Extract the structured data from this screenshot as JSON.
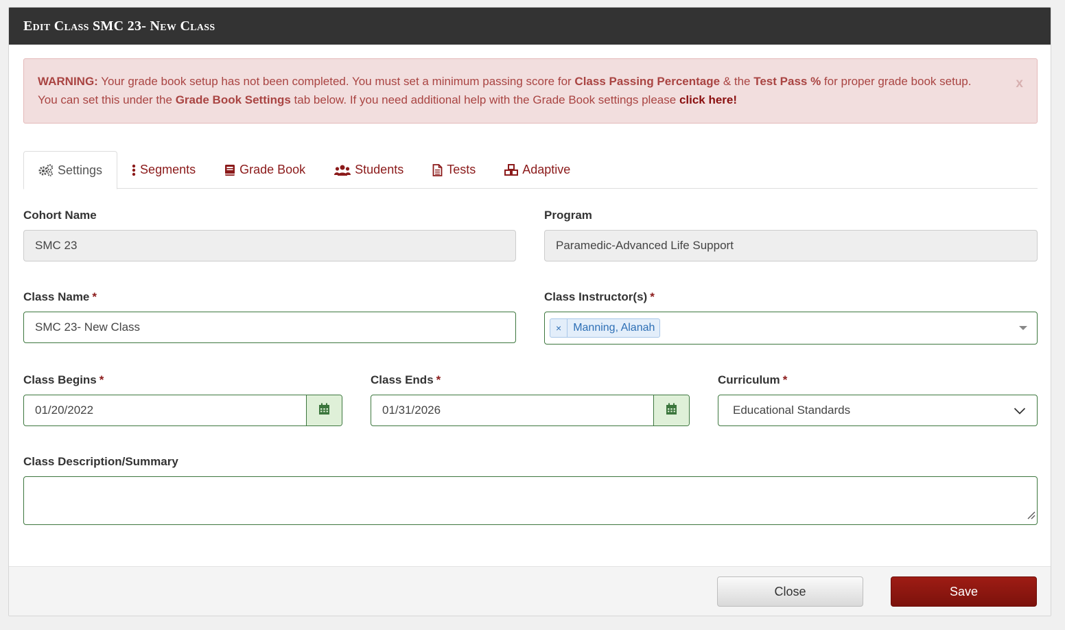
{
  "modal": {
    "title": "Edit Class SMC 23- New Class"
  },
  "alert": {
    "prefix": "WARNING:",
    "text1": " Your grade book setup has not been completed. You must set a minimum passing score for ",
    "bold1": "Class Passing Percentage",
    "text2": " & the ",
    "bold2": "Test Pass %",
    "text3": " for proper grade book setup.",
    "text4": "You can set this under the ",
    "bold3": "Grade Book Settings",
    "text5": " tab below. If you need additional help with the Grade Book settings please ",
    "link": "click here!",
    "close": "x"
  },
  "tabs": [
    {
      "label": "Settings",
      "icon": "gears-icon"
    },
    {
      "label": "Segments",
      "icon": "vertical-ellipsis-icon"
    },
    {
      "label": "Grade Book",
      "icon": "book-icon"
    },
    {
      "label": "Students",
      "icon": "users-icon"
    },
    {
      "label": "Tests",
      "icon": "file-text-icon"
    },
    {
      "label": "Adaptive",
      "icon": "cubes-icon"
    }
  ],
  "form": {
    "cohort_name": {
      "label": "Cohort Name",
      "value": "SMC 23"
    },
    "program": {
      "label": "Program",
      "value": "Paramedic-Advanced Life Support"
    },
    "class_name": {
      "label": "Class Name",
      "value": "SMC 23- New Class"
    },
    "instructors": {
      "label": "Class Instructor(s)",
      "tags": [
        "Manning, Alanah"
      ]
    },
    "class_begins": {
      "label": "Class Begins",
      "value": "01/20/2022"
    },
    "class_ends": {
      "label": "Class Ends",
      "value": "01/31/2026"
    },
    "curriculum": {
      "label": "Curriculum",
      "value": "Educational Standards"
    },
    "description": {
      "label": "Class Description/Summary",
      "value": ""
    },
    "required_mark": "*"
  },
  "footer": {
    "close_label": "Close",
    "save_label": "Save"
  },
  "colors": {
    "header": "#333333",
    "brand": "#8b1a1a",
    "alert_bg": "#f2dede",
    "valid": "#3c763d"
  }
}
